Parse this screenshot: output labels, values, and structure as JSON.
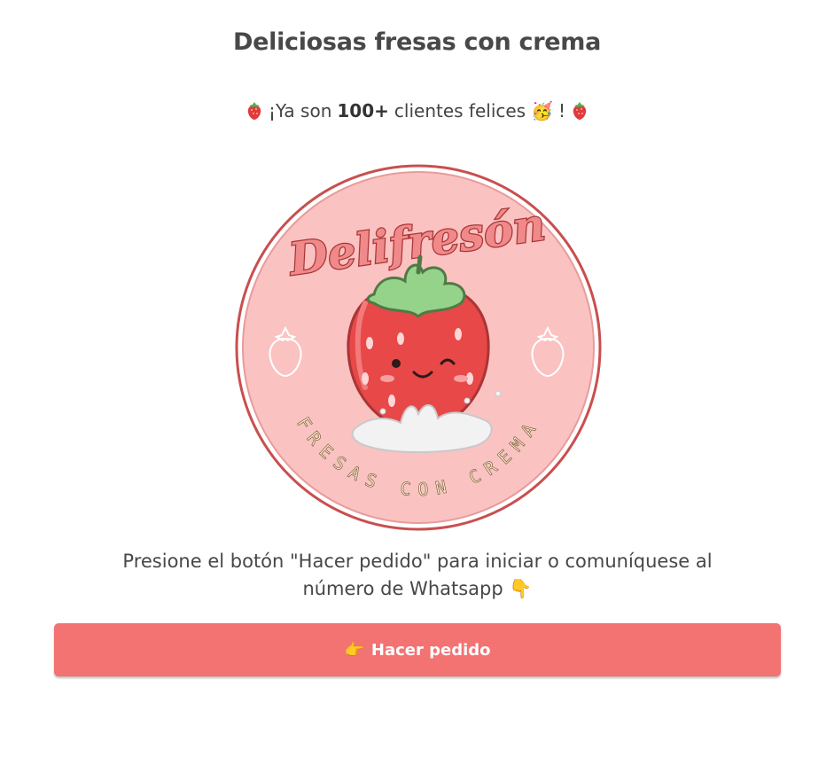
{
  "page": {
    "title": "Deliciosas fresas con crema"
  },
  "banner": {
    "prefix": "¡Ya son",
    "count": "100+",
    "suffix": "clientes felices",
    "party_emoji": "🥳",
    "exclaim": "!",
    "side_icon": "strawberry-icon"
  },
  "logo": {
    "brand": "Delifresón",
    "tagline": "FRESAS CON CREMA",
    "colors": {
      "background": "#fbc2c2",
      "border": "#c94f4f",
      "strawberry": "#e84848",
      "leaves": "#96d38a"
    }
  },
  "instructions": {
    "line1": "Presione el botón \"Hacer pedido\" para iniciar o comuníquese al",
    "line2": "número de Whatsapp",
    "emoji": "👇"
  },
  "cta": {
    "emoji": "👉",
    "label": "Hacer pedido",
    "color": "#f37272"
  }
}
